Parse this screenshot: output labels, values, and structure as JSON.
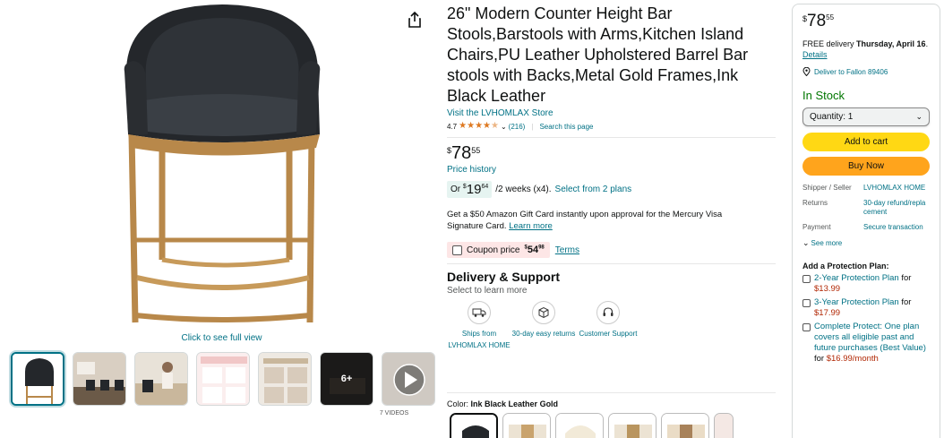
{
  "product": {
    "title": "26\" Modern Counter Height Bar Stools,Barstools with Arms,Kitchen Island Chairs,PU Leather Upholstered Barrel Bar stools with Backs,Metal Gold Frames,Ink Black Leather",
    "store_link": "Visit the LVHOMLAX Store",
    "rating_value": "4.7",
    "rating_stars": 4.5,
    "rating_count": "(216)",
    "search_page": "Search this page"
  },
  "gallery": {
    "full_view": "Click to see full view",
    "more_count": "6+",
    "video_count": "7 VIDEOS",
    "thumbnails": [
      "thumbnail-1",
      "thumbnail-2",
      "thumbnail-3",
      "thumbnail-4",
      "thumbnail-5",
      "thumbnail-6",
      "thumbnail-video"
    ]
  },
  "pricing": {
    "symbol": "$",
    "whole": "78",
    "fraction": "55",
    "price_history": "Price history",
    "installment_prefix": "Or ",
    "installment_whole": "19",
    "installment_fraction": "64",
    "installment_suffix": "/2 weeks (x4).",
    "installment_link": "Select from 2 plans"
  },
  "giftcard": {
    "text": "Get a $50 Amazon Gift Card instantly upon approval for the Mercury Visa Signature Card.",
    "link": "Learn more"
  },
  "coupon": {
    "label": "Coupon price",
    "price_whole": "54",
    "price_fraction": "98",
    "terms": "Terms"
  },
  "delivery_support": {
    "title": "Delivery & Support",
    "subtitle": "Select to learn more",
    "items": [
      {
        "label": "Ships from LVHOMLAX HOME",
        "icon": "truck-icon"
      },
      {
        "label": "30-day easy returns",
        "icon": "return-box-icon"
      },
      {
        "label": "Customer Support",
        "icon": "headset-icon"
      }
    ]
  },
  "color": {
    "label": "Color:",
    "value": "Ink Black Leather Gold"
  },
  "buybox": {
    "delivery_prefix": "FREE delivery",
    "delivery_date": "Thursday, April 16",
    "details": "Details",
    "deliver_to": "Deliver to Fallon 89406",
    "stock": "In Stock",
    "quantity": "Quantity: 1",
    "add_to_cart": "Add to cart",
    "buy_now": "Buy Now",
    "info": [
      {
        "key": "Shipper / Seller",
        "value": "LVHOMLAX HOME"
      },
      {
        "key": "Returns",
        "value": "30-day refund/replacement"
      },
      {
        "key": "Payment",
        "value": "Secure transaction"
      }
    ],
    "see_more": "See more",
    "protection_title": "Add a Protection Plan:",
    "protection": [
      {
        "label": "2-Year Protection Plan",
        "for": "for",
        "price": "$13.99"
      },
      {
        "label": "3-Year Protection Plan",
        "for": "for",
        "price": "$17.99"
      },
      {
        "label": "Complete Protect: One plan covers all eligible past and future purchases (Best Value)",
        "for": "for",
        "price": "$16.99/month"
      }
    ]
  },
  "colors": {
    "link": "#007185",
    "in_stock": "#007600",
    "add_to_cart": "#ffd814",
    "buy_now": "#ffa41c",
    "price_red": "#b12704",
    "star": "#de7921"
  }
}
